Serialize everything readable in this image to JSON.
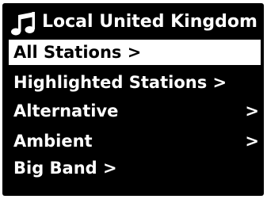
{
  "header": {
    "icon": "music-note-icon",
    "title": "Local United Kingdom"
  },
  "menu": {
    "items": [
      {
        "label": "All Stations >",
        "arrow": "",
        "selected": true
      },
      {
        "label": "Highlighted Stations >",
        "arrow": "",
        "selected": false
      },
      {
        "label": "Alternative",
        "arrow": ">",
        "selected": false
      },
      {
        "label": "Ambient",
        "arrow": ">",
        "selected": false
      },
      {
        "label": "Big Band >",
        "arrow": "",
        "selected": false
      }
    ]
  },
  "colors": {
    "background": "#000000",
    "text": "#ffffff",
    "highlight": "#ffffff",
    "highlight_text": "#000000"
  }
}
